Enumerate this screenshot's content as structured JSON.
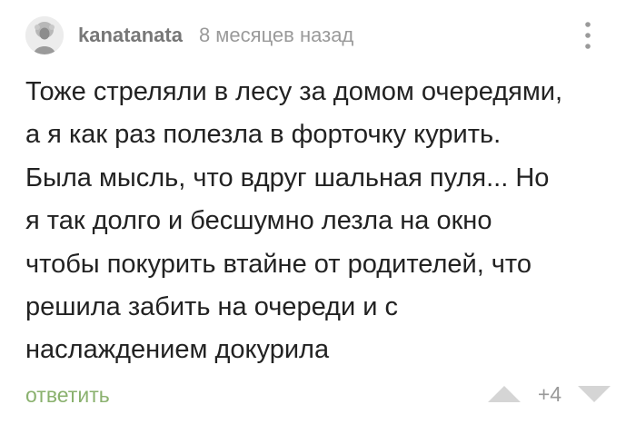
{
  "comment": {
    "author": {
      "username": "kanatanata",
      "avatar_icon": "avatar-portrait-icon"
    },
    "timestamp": "8 месяцев назад",
    "more_icon": "vertical-dots-icon",
    "body_lines": [
      "Тоже стреляли в лесу за домом очередями,",
      "а я как раз полезла в форточку курить.",
      "Была мысль, что вдруг шальная пуля... Но",
      "я так долго и бесшумно лезла на окно",
      "чтобы покурить втайне от родителей, что",
      "решила забить на очереди и с",
      "наслаждением докурила"
    ],
    "footer": {
      "reply_label": "ответить",
      "rating": "+4",
      "vote_up_icon": "triangle-up-icon",
      "vote_down_icon": "triangle-down-icon"
    }
  },
  "colors": {
    "text": "#222222",
    "meta": "#9a9a9a",
    "reply": "#8ab16e",
    "vote_arrow": "#d5d5d5"
  }
}
